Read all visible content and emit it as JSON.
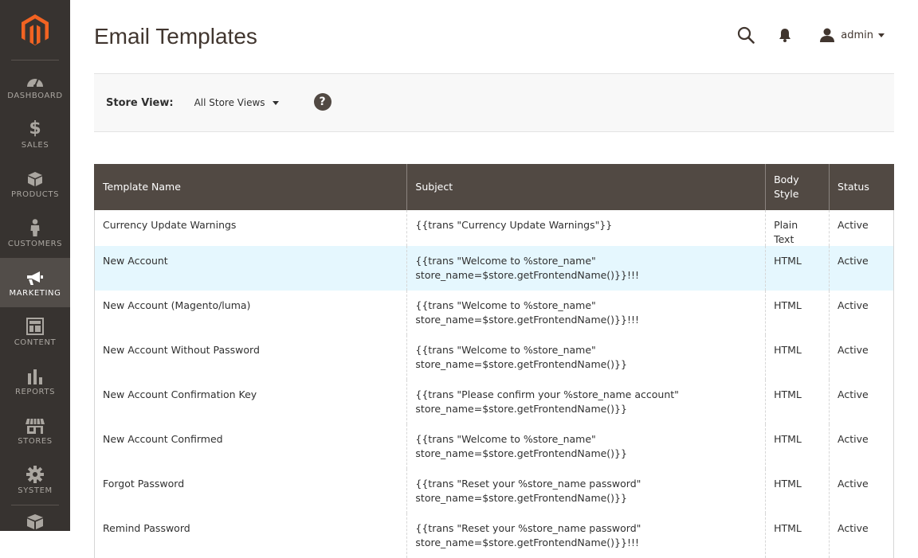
{
  "header": {
    "title": "Email Templates",
    "user_name": "admin"
  },
  "sidebar": {
    "items": [
      {
        "label": "DASHBOARD",
        "icon": "dashboard-icon"
      },
      {
        "label": "SALES",
        "icon": "dollar-icon"
      },
      {
        "label": "PRODUCTS",
        "icon": "box-icon"
      },
      {
        "label": "CUSTOMERS",
        "icon": "person-icon"
      },
      {
        "label": "MARKETING",
        "icon": "megaphone-icon"
      },
      {
        "label": "CONTENT",
        "icon": "layout-icon"
      },
      {
        "label": "REPORTS",
        "icon": "bar-chart-icon"
      },
      {
        "label": "STORES",
        "icon": "storefront-icon"
      },
      {
        "label": "SYSTEM",
        "icon": "gear-icon"
      }
    ],
    "active_index": 4
  },
  "store_view": {
    "label": "Store View:",
    "selected": "All Store Views"
  },
  "grid": {
    "columns": [
      "Template Name",
      "Subject",
      "Body Style",
      "Status"
    ],
    "rows": [
      {
        "name": "Currency Update Warnings",
        "subject1": "{{trans \"Currency Update Warnings\"}}",
        "subject2": "",
        "style": "Plain Text",
        "status": "Active"
      },
      {
        "name": "New Account",
        "subject1": "{{trans \"Welcome to %store_name\"",
        "subject2": "store_name=$store.getFrontendName()}}!!!",
        "style": "HTML",
        "status": "Active"
      },
      {
        "name": "New Account (Magento/luma)",
        "subject1": "{{trans \"Welcome to %store_name\"",
        "subject2": "store_name=$store.getFrontendName()}}!!!",
        "style": "HTML",
        "status": "Active"
      },
      {
        "name": "New Account Without Password",
        "subject1": "{{trans \"Welcome to %store_name\"",
        "subject2": "store_name=$store.getFrontendName()}}",
        "style": "HTML",
        "status": "Active"
      },
      {
        "name": "New Account Confirmation Key",
        "subject1": "{{trans \"Please confirm your %store_name account\"",
        "subject2": "store_name=$store.getFrontendName()}}",
        "style": "HTML",
        "status": "Active"
      },
      {
        "name": "New Account Confirmed",
        "subject1": "{{trans \"Welcome to %store_name\"",
        "subject2": "store_name=$store.getFrontendName()}}",
        "style": "HTML",
        "status": "Active"
      },
      {
        "name": "Forgot Password",
        "subject1": "{{trans \"Reset your %store_name password\"",
        "subject2": "store_name=$store.getFrontendName()}}",
        "style": "HTML",
        "status": "Active"
      },
      {
        "name": "Remind Password",
        "subject1": "{{trans \"Reset your %store_name password\"",
        "subject2": "store_name=$store.getFrontendName()}}!!!",
        "style": "HTML",
        "status": "Active"
      }
    ]
  },
  "colors": {
    "sidebar_bg": "#373330",
    "sidebar_active": "#524d49",
    "header_bg": "#514943",
    "logo_orange": "#f26322",
    "row_highlight": "#e5f7fe"
  }
}
